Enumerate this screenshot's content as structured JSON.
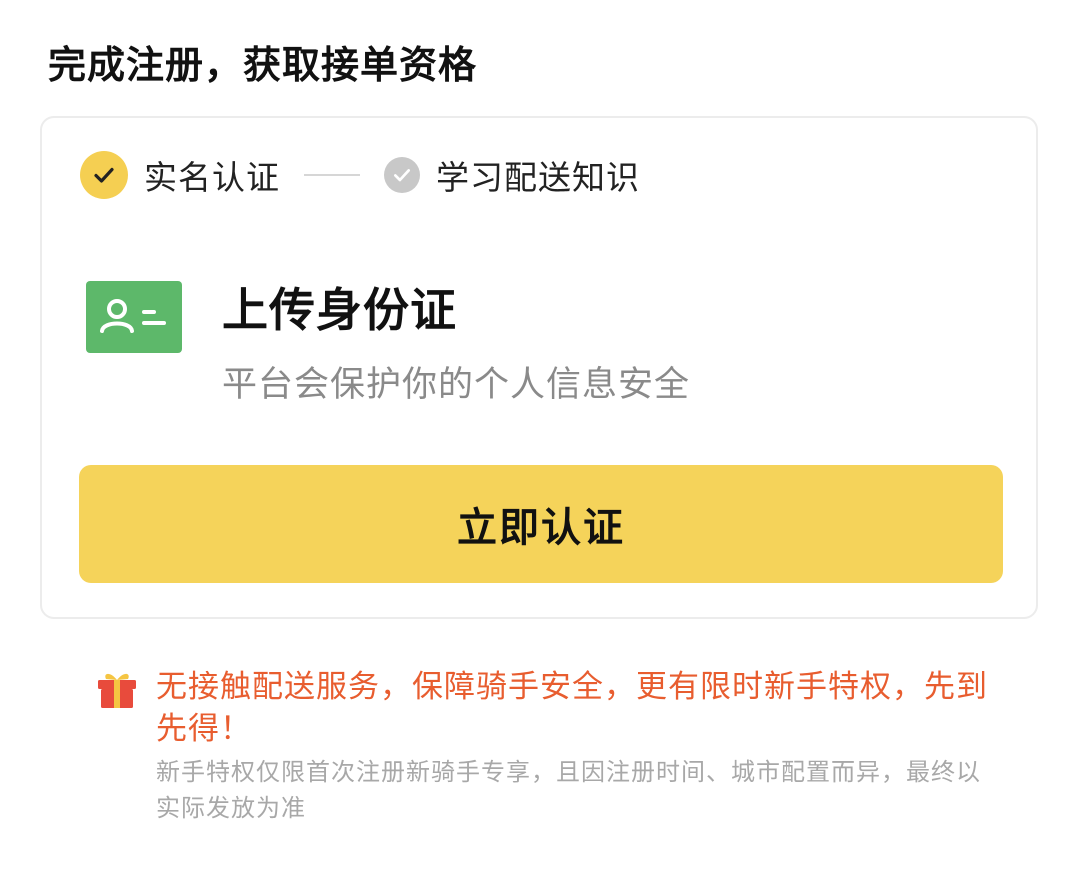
{
  "header": {
    "title": "完成注册，获取接单资格"
  },
  "steps": [
    {
      "label": "实名认证",
      "status": "done",
      "icon": "check-circle-icon"
    },
    {
      "label": "学习配送知识",
      "status": "todo",
      "icon": "check-circle-icon"
    }
  ],
  "upload": {
    "icon": "id-card-icon",
    "title": "上传身份证",
    "subtitle": "平台会保护你的个人信息安全"
  },
  "actions": {
    "verify_label": "立即认证"
  },
  "promo": {
    "icon": "gift-icon",
    "headline": "无接触配送服务，保障骑手安全，更有限时新手特权，先到先得！",
    "note": "新手特权仅限首次注册新骑手专享，且因注册时间、城市配置而异，最终以实际发放为准"
  },
  "colors": {
    "accent_yellow": "#f5d35a",
    "step_done": "#f5cf52",
    "step_todo": "#c8c8c8",
    "id_card_green": "#5db86a",
    "promo_orange": "#e85d2f",
    "muted_text": "#8a8a8a"
  }
}
